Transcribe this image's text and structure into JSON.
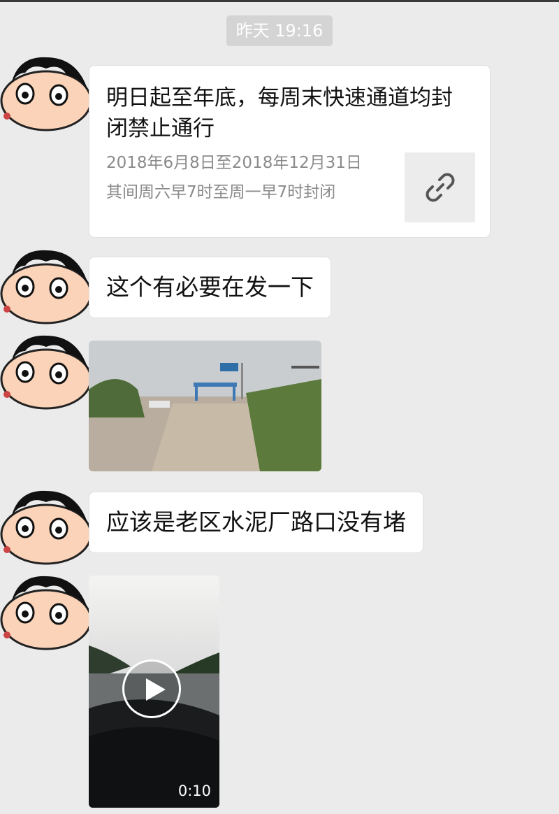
{
  "chat": {
    "timestamp": "昨天 19:16",
    "messages": [
      {
        "type": "link",
        "title": "明日起至年底，每周末快速通道均封闭禁止通行",
        "description": [
          "2018年6月8日至2018年12月31日",
          "其间周六早7时至周一早7时封闭"
        ],
        "icon": "link-icon"
      },
      {
        "type": "text",
        "text": "这个有必要在发一下"
      },
      {
        "type": "image",
        "icon": "road-photo"
      },
      {
        "type": "text",
        "text": "应该是老区水泥厂路口没有堵"
      },
      {
        "type": "video",
        "duration": "0:10",
        "icon": "play-icon"
      }
    ]
  }
}
